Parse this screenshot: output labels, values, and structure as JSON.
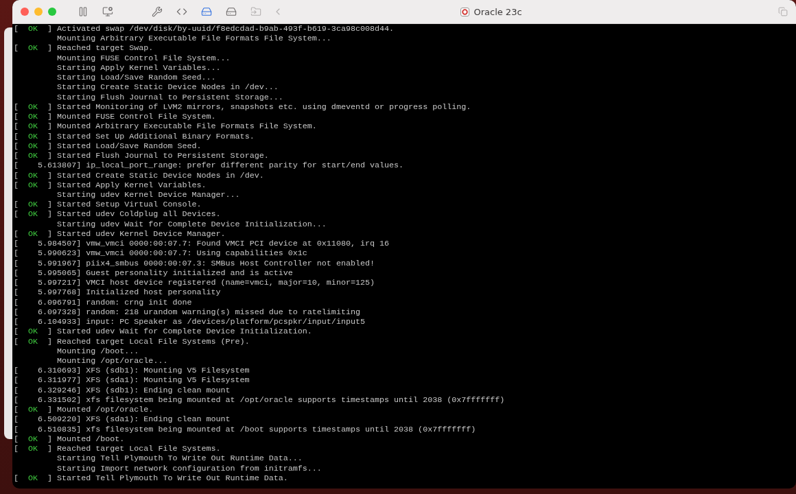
{
  "window": {
    "title": "Oracle 23c"
  },
  "toolbar": [
    {
      "kind": "pause",
      "selected": false,
      "disabled": false
    },
    {
      "kind": "snapshot",
      "selected": false,
      "disabled": false
    },
    {
      "kind": "settings",
      "selected": false,
      "disabled": false
    },
    {
      "kind": "network",
      "selected": false,
      "disabled": false
    },
    {
      "kind": "drive",
      "selected": true,
      "disabled": false
    },
    {
      "kind": "drive",
      "selected": false,
      "disabled": false
    },
    {
      "kind": "folder",
      "selected": false,
      "disabled": true
    },
    {
      "kind": "back",
      "selected": false,
      "disabled": true
    }
  ],
  "console": {
    "lines": [
      {
        "kind": "status",
        "open": "[",
        "status": "OK",
        "close": "]",
        "text": "Activated swap /dev/disk/by-uuid/f8edcdad-b9ab-493f-b619-3ca98c008d44."
      },
      {
        "kind": "plain",
        "text": "Mounting Arbitrary Executable File Formats File System..."
      },
      {
        "kind": "status",
        "open": "[",
        "status": "OK",
        "close": "]",
        "text": "Reached target Swap."
      },
      {
        "kind": "plain",
        "text": "Mounting FUSE Control File System..."
      },
      {
        "kind": "plain",
        "text": "Starting Apply Kernel Variables..."
      },
      {
        "kind": "plain",
        "text": "Starting Load/Save Random Seed..."
      },
      {
        "kind": "plain",
        "text": "Starting Create Static Device Nodes in /dev..."
      },
      {
        "kind": "plain",
        "text": "Starting Flush Journal to Persistent Storage..."
      },
      {
        "kind": "status",
        "open": "[",
        "status": "OK",
        "close": "]",
        "text": "Started Monitoring of LVM2 mirrors, snapshots etc. using dmeventd or progress polling."
      },
      {
        "kind": "status",
        "open": "[",
        "status": "OK",
        "close": "]",
        "text": "Mounted FUSE Control File System."
      },
      {
        "kind": "status",
        "open": "[",
        "status": "OK",
        "close": "]",
        "text": "Mounted Arbitrary Executable File Formats File System."
      },
      {
        "kind": "status",
        "open": "[",
        "status": "OK",
        "close": "]",
        "text": "Started Set Up Additional Binary Formats."
      },
      {
        "kind": "status",
        "open": "[",
        "status": "OK",
        "close": "]",
        "text": "Started Load/Save Random Seed."
      },
      {
        "kind": "status",
        "open": "[",
        "status": "OK",
        "close": "]",
        "text": "Started Flush Journal to Persistent Storage."
      },
      {
        "kind": "kernel",
        "open": "[",
        "time": "5.613807",
        "close": "]",
        "text": "ip_local_port_range: prefer different parity for start/end values."
      },
      {
        "kind": "status",
        "open": "[",
        "status": "OK",
        "close": "]",
        "text": "Started Create Static Device Nodes in /dev."
      },
      {
        "kind": "status",
        "open": "[",
        "status": "OK",
        "close": "]",
        "text": "Started Apply Kernel Variables."
      },
      {
        "kind": "plain",
        "text": "Starting udev Kernel Device Manager..."
      },
      {
        "kind": "status",
        "open": "[",
        "status": "OK",
        "close": "]",
        "text": "Started Setup Virtual Console."
      },
      {
        "kind": "status",
        "open": "[",
        "status": "OK",
        "close": "]",
        "text": "Started udev Coldplug all Devices."
      },
      {
        "kind": "plain",
        "text": "Starting udev Wait for Complete Device Initialization..."
      },
      {
        "kind": "status",
        "open": "[",
        "status": "OK",
        "close": "]",
        "text": "Started udev Kernel Device Manager."
      },
      {
        "kind": "kernel",
        "open": "[",
        "time": "5.984507",
        "close": "]",
        "text": "vmw_vmci 0000:00:07.7: Found VMCI PCI device at 0x11080, irq 16"
      },
      {
        "kind": "kernel",
        "open": "[",
        "time": "5.990623",
        "close": "]",
        "text": "vmw_vmci 0000:00:07.7: Using capabilities 0x1c"
      },
      {
        "kind": "kernel",
        "open": "[",
        "time": "5.991967",
        "close": "]",
        "text": "piix4_smbus 0000:00:07.3: SMBus Host Controller not enabled!"
      },
      {
        "kind": "kernel",
        "open": "[",
        "time": "5.995065",
        "close": "]",
        "text": "Guest personality initialized and is active"
      },
      {
        "kind": "kernel",
        "open": "[",
        "time": "5.997217",
        "close": "]",
        "text": "VMCI host device registered (name=vmci, major=10, minor=125)"
      },
      {
        "kind": "kernel",
        "open": "[",
        "time": "5.997768",
        "close": "]",
        "text": "Initialized host personality"
      },
      {
        "kind": "kernel",
        "open": "[",
        "time": "6.096791",
        "close": "]",
        "text": "random: crng init done"
      },
      {
        "kind": "kernel",
        "open": "[",
        "time": "6.097328",
        "close": "]",
        "text": "random: 218 urandom warning(s) missed due to ratelimiting"
      },
      {
        "kind": "kernel",
        "open": "[",
        "time": "6.104933",
        "close": "]",
        "text": "input: PC Speaker as /devices/platform/pcspkr/input/input5"
      },
      {
        "kind": "status",
        "open": "[",
        "status": "OK",
        "close": "]",
        "text": "Started udev Wait for Complete Device Initialization."
      },
      {
        "kind": "status",
        "open": "[",
        "status": "OK",
        "close": "]",
        "text": "Reached target Local File Systems (Pre)."
      },
      {
        "kind": "plain",
        "text": "Mounting /boot..."
      },
      {
        "kind": "plain",
        "text": "Mounting /opt/oracle..."
      },
      {
        "kind": "kernel",
        "open": "[",
        "time": "6.310693",
        "close": "]",
        "text": "XFS (sdb1): Mounting V5 Filesystem"
      },
      {
        "kind": "kernel",
        "open": "[",
        "time": "6.311977",
        "close": "]",
        "text": "XFS (sda1): Mounting V5 Filesystem"
      },
      {
        "kind": "kernel",
        "open": "[",
        "time": "6.329246",
        "close": "]",
        "text": "XFS (sdb1): Ending clean mount"
      },
      {
        "kind": "kernel",
        "open": "[",
        "time": "6.331502",
        "close": "]",
        "text": "xfs filesystem being mounted at /opt/oracle supports timestamps until 2038 (0x7fffffff)"
      },
      {
        "kind": "status",
        "open": "[",
        "status": "OK",
        "close": "]",
        "text": "Mounted /opt/oracle."
      },
      {
        "kind": "kernel",
        "open": "[",
        "time": "6.509220",
        "close": "]",
        "text": "XFS (sda1): Ending clean mount"
      },
      {
        "kind": "kernel",
        "open": "[",
        "time": "6.510835",
        "close": "]",
        "text": "xfs filesystem being mounted at /boot supports timestamps until 2038 (0x7fffffff)"
      },
      {
        "kind": "status",
        "open": "[",
        "status": "OK",
        "close": "]",
        "text": "Mounted /boot."
      },
      {
        "kind": "status",
        "open": "[",
        "status": "OK",
        "close": "]",
        "text": "Reached target Local File Systems."
      },
      {
        "kind": "plain",
        "text": "Starting Tell Plymouth To Write Out Runtime Data..."
      },
      {
        "kind": "plain",
        "text": "Starting Import network configuration from initramfs..."
      },
      {
        "kind": "status",
        "open": "[",
        "status": "OK",
        "close": "]",
        "text": "Started Tell Plymouth To Write Out Runtime Data."
      }
    ]
  }
}
